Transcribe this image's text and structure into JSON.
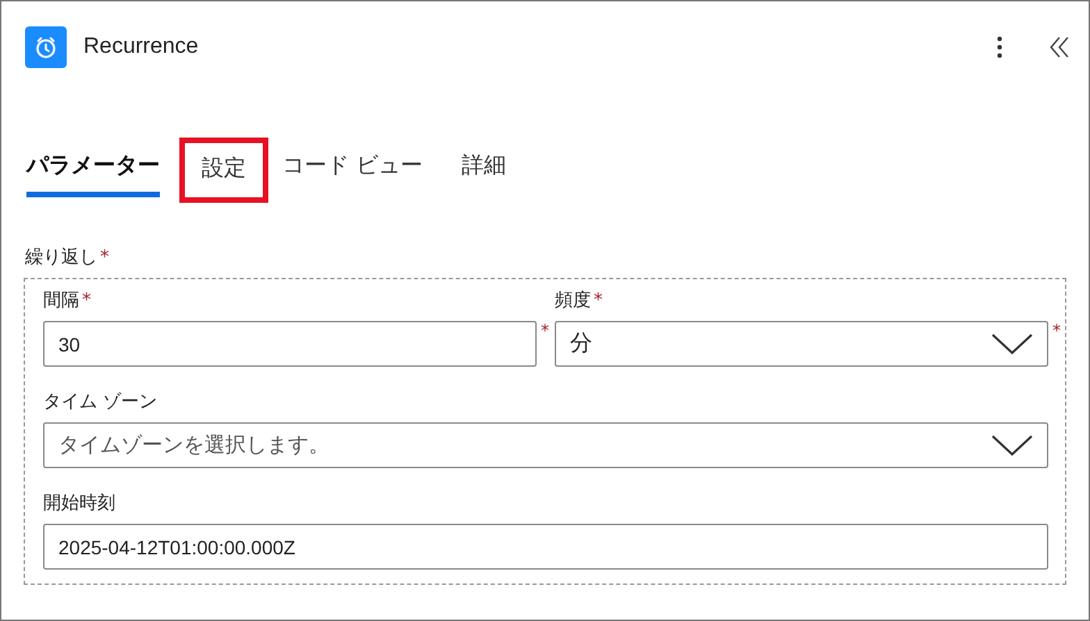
{
  "header": {
    "title": "Recurrence"
  },
  "tabs": [
    {
      "label": "パラメーター",
      "selected": true,
      "highlighted": false
    },
    {
      "label": "設定",
      "selected": false,
      "highlighted": true
    },
    {
      "label": "コード ビュー",
      "selected": false,
      "highlighted": false
    },
    {
      "label": "詳細",
      "selected": false,
      "highlighted": false
    }
  ],
  "section": {
    "label": "繰り返し",
    "required_mark": "*"
  },
  "fields": [
    {
      "kind": "text",
      "label": "間隔",
      "required_mark": "*",
      "value": "30",
      "side_mark": "*"
    },
    {
      "kind": "dropdown",
      "label": "頻度",
      "required_mark": "*",
      "value": "分",
      "side_mark": "*"
    },
    {
      "kind": "dropdown",
      "label": "タイム ゾーン",
      "placeholder": "タイムゾーンを選択します。"
    },
    {
      "kind": "text",
      "label": "開始時刻",
      "value": "2025-04-12T01:00:00.000Z"
    }
  ]
}
